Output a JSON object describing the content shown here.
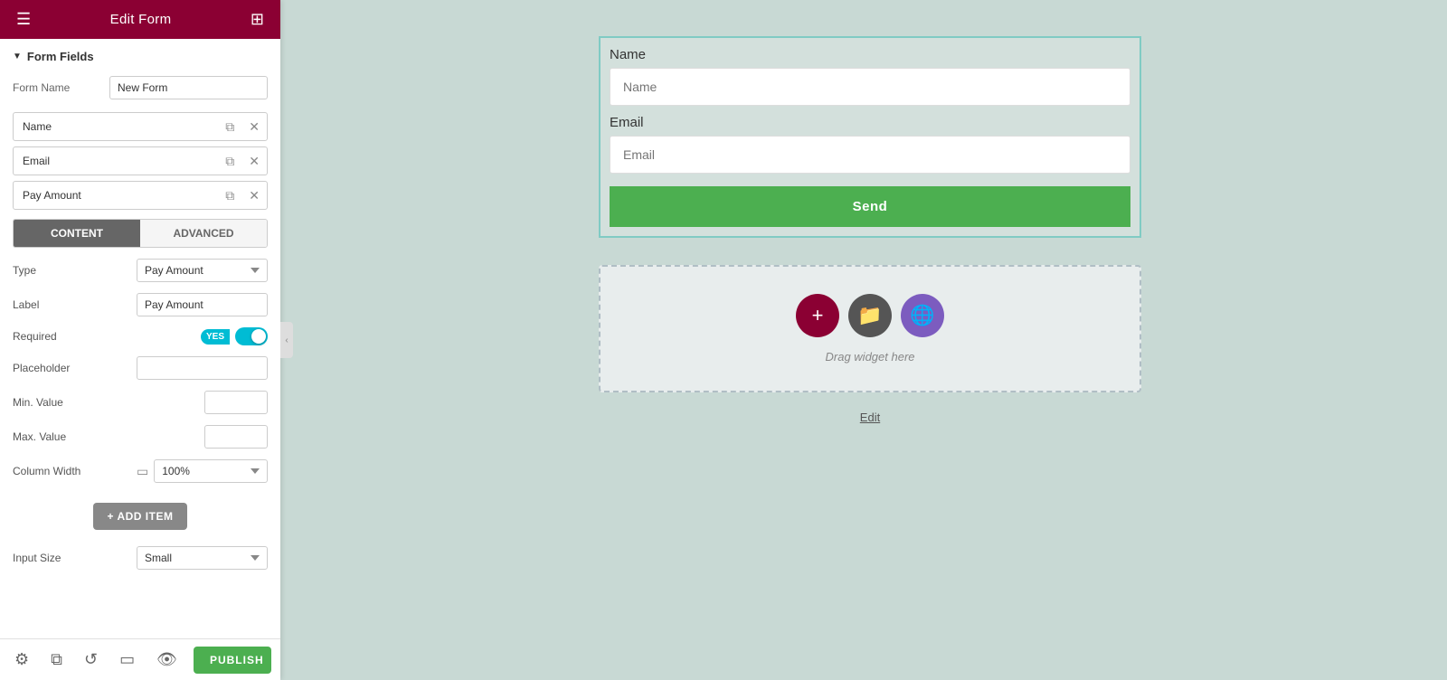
{
  "header": {
    "title": "Edit Form",
    "menu_icon": "☰",
    "grid_icon": "⊞"
  },
  "sidebar": {
    "form_fields_label": "Form Fields",
    "form_name_label": "Form Name",
    "form_name_value": "New Form",
    "fields": [
      {
        "label": "Name"
      },
      {
        "label": "Email"
      },
      {
        "label": "Pay Amount"
      }
    ],
    "tabs": [
      {
        "label": "CONTENT",
        "active": true
      },
      {
        "label": "ADVANCED",
        "active": false
      }
    ],
    "settings": {
      "type_label": "Type",
      "type_value": "Pay Amount",
      "label_label": "Label",
      "label_value": "Pay Amount",
      "required_label": "Required",
      "required_yes": "YES",
      "placeholder_label": "Placeholder",
      "min_value_label": "Min. Value",
      "max_value_label": "Max. Value",
      "column_width_label": "Column Width",
      "column_width_value": "100%",
      "input_size_label": "Input Size",
      "input_size_value": "Small"
    },
    "add_item_label": "+ ADD ITEM",
    "publish_label": "PUBLISH"
  },
  "main": {
    "form": {
      "name_label": "Name",
      "name_placeholder": "Name",
      "email_label": "Email",
      "email_placeholder": "Email",
      "send_label": "Send"
    },
    "drag_area": {
      "text": "Drag widget here"
    },
    "edit_link": "Edit"
  }
}
